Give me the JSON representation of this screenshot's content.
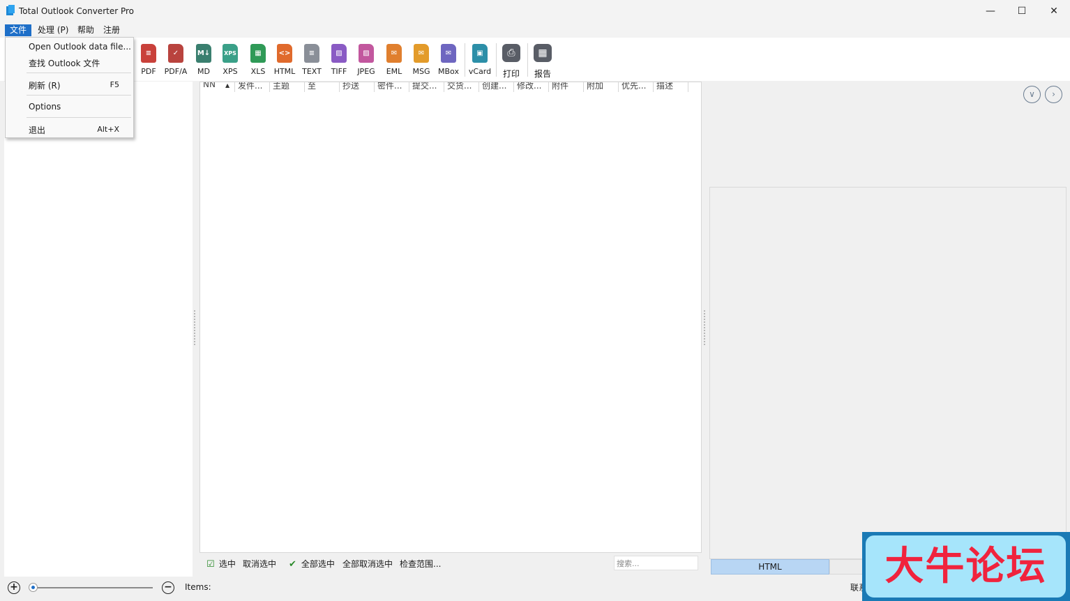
{
  "window": {
    "title": "Total Outlook Converter Pro",
    "minimize": "—",
    "maximize": "☐",
    "close": "✕"
  },
  "menubar": [
    "文件",
    "处理 (P)",
    "帮助",
    "注册"
  ],
  "file_menu": {
    "open": "Open Outlook data file...",
    "find": "查找 Outlook 文件",
    "refresh": "刷新 (R)",
    "refresh_shortcut": "F5",
    "options": "Options",
    "exit": "退出",
    "exit_shortcut": "Alt+X"
  },
  "toolbar": [
    {
      "label": "PDF",
      "icon": "pdf-icon",
      "color": "#c9413b",
      "glyph": "≡"
    },
    {
      "label": "PDF/A",
      "icon": "pdfa-icon",
      "color": "#b9433e",
      "glyph": "✓"
    },
    {
      "label": "MD",
      "icon": "markdown-icon",
      "color": "#3a7f6f",
      "glyph": "M↓"
    },
    {
      "label": "XPS",
      "icon": "xps-icon",
      "color": "#3aa088",
      "glyph": "XPS"
    },
    {
      "label": "XLS",
      "icon": "excel-icon",
      "color": "#2f9a57",
      "glyph": "▦"
    },
    {
      "label": "HTML",
      "icon": "html-icon",
      "color": "#e06a2c",
      "glyph": "<>"
    },
    {
      "label": "TEXT",
      "icon": "text-icon",
      "color": "#8a8f98",
      "glyph": "≡"
    },
    {
      "label": "TIFF",
      "icon": "tiff-icon",
      "color": "#8a5bc4",
      "glyph": "▨"
    },
    {
      "label": "JPEG",
      "icon": "jpeg-icon",
      "color": "#c2579e",
      "glyph": "▨"
    },
    {
      "label": "EML",
      "icon": "eml-icon",
      "color": "#e07f2e",
      "glyph": "✉"
    },
    {
      "label": "MSG",
      "icon": "msg-icon",
      "color": "#e39b2a",
      "glyph": "✉"
    },
    {
      "label": "MBox",
      "icon": "mbox-icon",
      "color": "#6e66c0",
      "glyph": "✉"
    },
    {
      "label": "vCard",
      "icon": "vcard-icon",
      "color": "#2c8fa8",
      "glyph": "▣"
    }
  ],
  "toolbar_actions": {
    "print": "打印",
    "report": "报告"
  },
  "grid": {
    "columns": [
      "NN",
      "发件...",
      "主题",
      "至",
      "抄送",
      "密件...",
      "提交...",
      "交货...",
      "创建...",
      "修改...",
      "附件",
      "附加",
      "优先...",
      "描述"
    ]
  },
  "footer": {
    "select": "选中",
    "deselect": "取消选中",
    "select_all": "全部选中",
    "deselect_all": "全部取消选中",
    "check_range": "检查范围...",
    "search_placeholder": "搜索..."
  },
  "preview": {
    "tab_html": "HTML"
  },
  "status": {
    "items_label": "Items:",
    "contact": "联系"
  },
  "watermark": "大牛论坛"
}
